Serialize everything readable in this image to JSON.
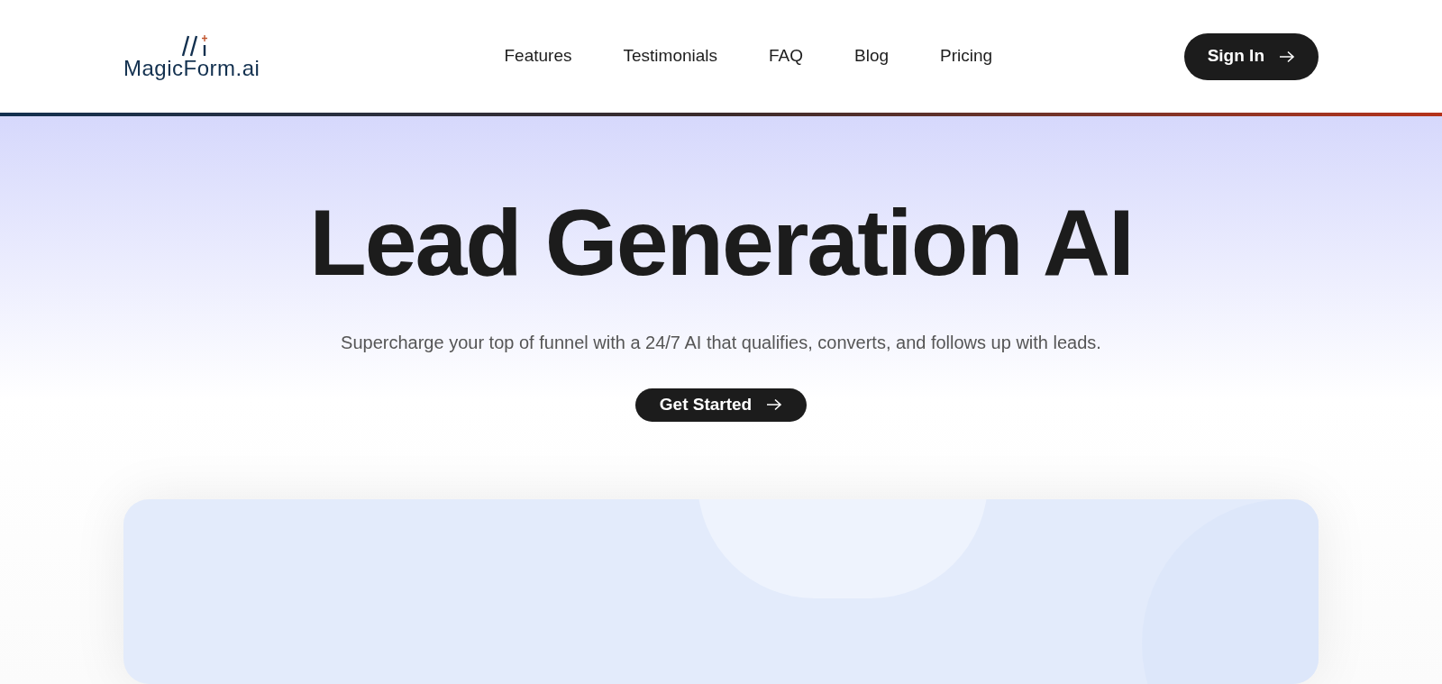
{
  "logo": {
    "text": "MagicForm.ai"
  },
  "nav": [
    "Features",
    "Testimonials",
    "FAQ",
    "Blog",
    "Pricing"
  ],
  "sign_in": {
    "label": "Sign In"
  },
  "hero": {
    "title": "Lead Generation AI",
    "subtitle": "Supercharge your top of funnel with a 24/7 AI that qualifies, converts, and follows up with leads.",
    "cta": "Get Started"
  }
}
